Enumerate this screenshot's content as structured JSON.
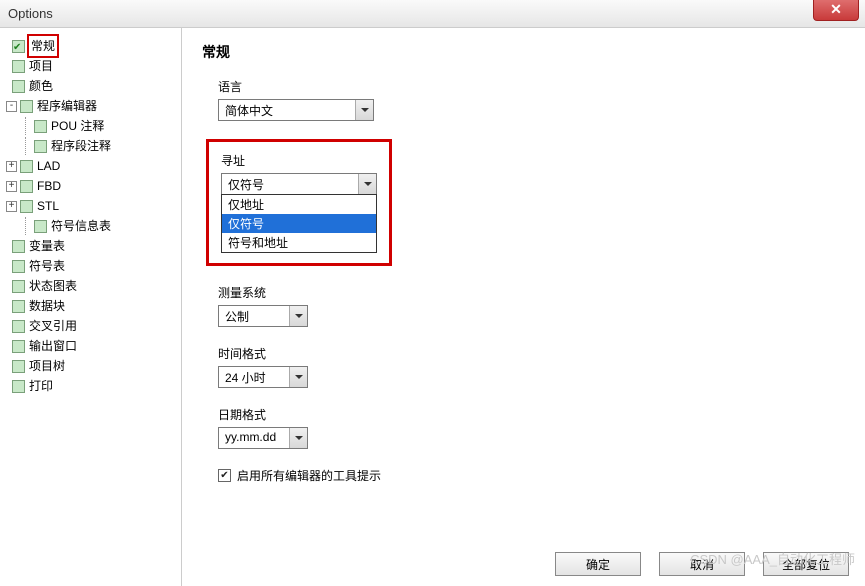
{
  "window": {
    "title": "Options"
  },
  "tree": {
    "items": [
      {
        "label": "常规",
        "checked": true,
        "highlight": true,
        "indent": 0
      },
      {
        "label": "项目",
        "indent": 0
      },
      {
        "label": "颜色",
        "indent": 0
      },
      {
        "label": "程序编辑器",
        "indent": 0,
        "expander": "-"
      },
      {
        "label": "POU 注释",
        "indent": 1
      },
      {
        "label": "程序段注释",
        "indent": 1
      },
      {
        "label": "LAD",
        "indent": 0,
        "expander": "+"
      },
      {
        "label": "FBD",
        "indent": 0,
        "expander": "+"
      },
      {
        "label": "STL",
        "indent": 0,
        "expander": "+"
      },
      {
        "label": "符号信息表",
        "indent": 1
      },
      {
        "label": "变量表",
        "indent": 0
      },
      {
        "label": "符号表",
        "indent": 0
      },
      {
        "label": "状态图表",
        "indent": 0
      },
      {
        "label": "数据块",
        "indent": 0
      },
      {
        "label": "交叉引用",
        "indent": 0
      },
      {
        "label": "输出窗口",
        "indent": 0
      },
      {
        "label": "项目树",
        "indent": 0
      },
      {
        "label": "打印",
        "indent": 0
      }
    ]
  },
  "page": {
    "title": "常规",
    "language": {
      "label": "语言",
      "value": "简体中文"
    },
    "addressing": {
      "label": "寻址",
      "value": "仅符号",
      "options": [
        "仅地址",
        "仅符号",
        "符号和地址"
      ],
      "selected_index": 1
    },
    "measurement": {
      "label": "测量系统",
      "value": "公制"
    },
    "time": {
      "label": "时间格式",
      "value": "24 小时"
    },
    "date": {
      "label": "日期格式",
      "value": "yy.mm.dd"
    },
    "tooltip_checkbox": {
      "label": "启用所有编辑器的工具提示",
      "checked": true
    }
  },
  "buttons": {
    "ok": "确定",
    "cancel": "取消",
    "reset": "全部复位"
  },
  "watermark": "CSDN @AAA_自动化工程师"
}
